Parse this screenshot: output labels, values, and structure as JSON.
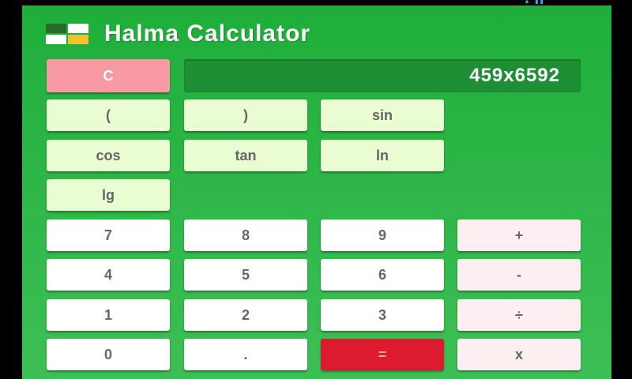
{
  "app": {
    "title": "Halma Calculator"
  },
  "display": {
    "expression": "459x6592"
  },
  "buttons": {
    "clear": "C",
    "lparen": "(",
    "rparen": ")",
    "sin": "sin",
    "cos": "cos",
    "tan": "tan",
    "ln": "ln",
    "lg": "lg",
    "d7": "7",
    "d8": "8",
    "d9": "9",
    "plus": "+",
    "d4": "4",
    "d5": "5",
    "d6": "6",
    "minus": "-",
    "d1": "1",
    "d2": "2",
    "d3": "3",
    "divide": "÷",
    "d0": "0",
    "dot": ".",
    "equals": "=",
    "multiply": "x"
  },
  "colors": {
    "background": "#1fae3a",
    "display": "#1e8f35",
    "function_key": "#e9fcd2",
    "digit_key": "#ffffff",
    "operator_key": "#fdeef2",
    "clear_key": "#f89aa4",
    "equals_key": "#dc1a30"
  },
  "icons": {
    "app_logo": "halma-logo-icon"
  }
}
